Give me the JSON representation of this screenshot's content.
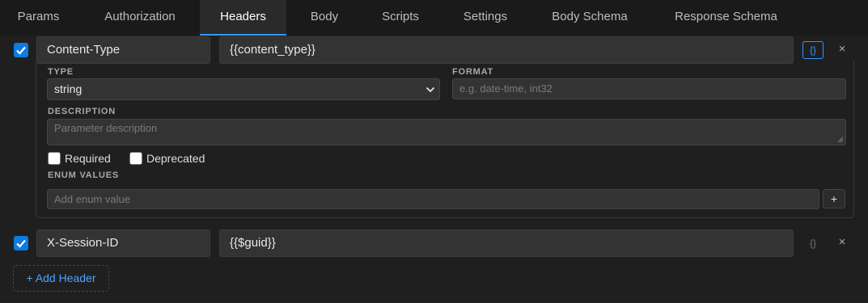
{
  "tabs": [
    "Params",
    "Authorization",
    "Headers",
    "Body",
    "Scripts",
    "Settings",
    "Body Schema",
    "Response Schema"
  ],
  "active_tab": "Headers",
  "headers": [
    {
      "enabled": true,
      "key": "Content-Type",
      "value": "{{content_type}}",
      "schema_icon": "{}",
      "expanded": true
    },
    {
      "enabled": true,
      "key": "X-Session-ID",
      "value": "{{$guid}}",
      "schema_icon": "{}",
      "expanded": false
    }
  ],
  "close_glyph": "×",
  "schema_panel": {
    "type_label": "TYPE",
    "type_value": "string",
    "format_label": "FORMAT",
    "format_placeholder": "e.g. date-time, int32",
    "description_label": "DESCRIPTION",
    "description_placeholder": "Parameter description",
    "required_label": "Required",
    "deprecated_label": "Deprecated",
    "enum_label": "ENUM VALUES",
    "enum_placeholder": "Add enum value",
    "enum_add": "+"
  },
  "add_header_label": "+ Add Header",
  "colors": {
    "accent": "#3794ff",
    "checkbox": "#0e7be0",
    "background": "#1f1f1f"
  }
}
